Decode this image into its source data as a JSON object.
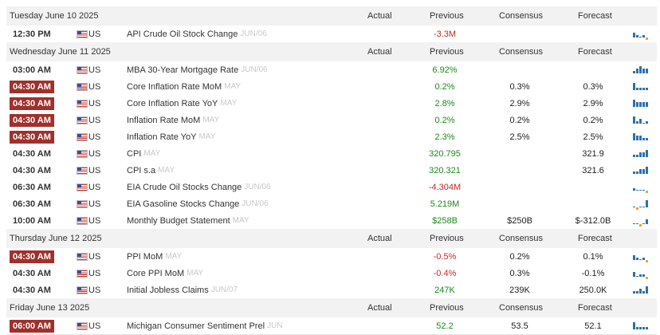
{
  "columns": {
    "actual": "Actual",
    "previous": "Previous",
    "consensus": "Consensus",
    "forecast": "Forecast"
  },
  "groups": [
    {
      "date": "Tuesday June 10 2025",
      "events": [
        {
          "time": "12:30 PM",
          "impact": "normal",
          "country": "US",
          "event": "API Crude Oil Stock Change",
          "ref": "JUN/06",
          "actual": "",
          "previous": "-3.3M",
          "previous_color": "red",
          "consensus": "",
          "forecast": "",
          "spark": [
            2,
            1,
            0,
            1,
            -1
          ]
        }
      ]
    },
    {
      "date": "Wednesday June 11 2025",
      "events": [
        {
          "time": "03:00 AM",
          "impact": "normal",
          "country": "US",
          "event": "MBA 30-Year Mortgage Rate",
          "ref": "JUN/06",
          "actual": "",
          "previous": "6.92%",
          "previous_color": "green",
          "consensus": "",
          "forecast": "",
          "spark": [
            1,
            2,
            3,
            2,
            2
          ]
        },
        {
          "time": "04:30 AM",
          "impact": "high",
          "country": "US",
          "event": "Core Inflation Rate MoM",
          "ref": "MAY",
          "actual": "",
          "previous": "0.2%",
          "previous_color": "green",
          "consensus": "0.3%",
          "forecast": "0.3%",
          "spark": [
            3,
            1,
            1,
            1,
            1
          ]
        },
        {
          "time": "04:30 AM",
          "impact": "high",
          "country": "US",
          "event": "Core Inflation Rate YoY",
          "ref": "MAY",
          "actual": "",
          "previous": "2.8%",
          "previous_color": "green",
          "consensus": "2.9%",
          "forecast": "2.9%",
          "spark": [
            3,
            2,
            2,
            2,
            2
          ]
        },
        {
          "time": "04:30 AM",
          "impact": "high",
          "country": "US",
          "event": "Inflation Rate MoM",
          "ref": "MAY",
          "actual": "",
          "previous": "0.2%",
          "previous_color": "green",
          "consensus": "0.2%",
          "forecast": "0.2%",
          "spark": [
            3,
            1,
            2,
            0,
            1
          ]
        },
        {
          "time": "04:30 AM",
          "impact": "high",
          "country": "US",
          "event": "Inflation Rate YoY",
          "ref": "MAY",
          "actual": "",
          "previous": "2.3%",
          "previous_color": "green",
          "consensus": "2.5%",
          "forecast": "2.5%",
          "spark": [
            3,
            2,
            2,
            1,
            1
          ]
        },
        {
          "time": "04:30 AM",
          "impact": "normal",
          "country": "US",
          "event": "CPI",
          "ref": "MAY",
          "actual": "",
          "previous": "320.795",
          "previous_color": "green",
          "consensus": "",
          "forecast": "321.9",
          "spark": [
            1,
            1,
            2,
            2,
            3
          ]
        },
        {
          "time": "04:30 AM",
          "impact": "normal",
          "country": "US",
          "event": "CPI s.a",
          "ref": "MAY",
          "actual": "",
          "previous": "320.321",
          "previous_color": "green",
          "consensus": "",
          "forecast": "321.6",
          "spark": [
            1,
            1,
            2,
            2,
            3
          ]
        },
        {
          "time": "06:30 AM",
          "impact": "normal",
          "country": "US",
          "event": "EIA Crude Oil Stocks Change",
          "ref": "JUN/06",
          "actual": "",
          "previous": "-4.304M",
          "previous_color": "red",
          "consensus": "",
          "forecast": "",
          "spark": [
            1,
            0,
            0,
            0,
            -2
          ]
        },
        {
          "time": "06:30 AM",
          "impact": "normal",
          "country": "US",
          "event": "EIA Gasoline Stocks Change",
          "ref": "JUN/06",
          "actual": "",
          "previous": "5.219M",
          "previous_color": "green",
          "consensus": "",
          "forecast": "",
          "spark": [
            0,
            -1,
            0,
            0,
            3
          ]
        },
        {
          "time": "10:00 AM",
          "impact": "normal",
          "country": "US",
          "event": "Monthly Budget Statement",
          "ref": "MAY",
          "actual": "",
          "previous": "$258B",
          "previous_color": "green",
          "consensus": "$250B",
          "forecast": "$-312.0B",
          "spark": [
            0,
            0,
            -1,
            0,
            2
          ]
        }
      ]
    },
    {
      "date": "Thursday June 12 2025",
      "events": [
        {
          "time": "04:30 AM",
          "impact": "high",
          "country": "US",
          "event": "PPI MoM",
          "ref": "MAY",
          "actual": "",
          "previous": "-0.5%",
          "previous_color": "red",
          "consensus": "0.2%",
          "forecast": "0.1%",
          "spark": [
            2,
            1,
            0,
            1,
            -1
          ]
        },
        {
          "time": "04:30 AM",
          "impact": "normal",
          "country": "US",
          "event": "Core PPI MoM",
          "ref": "MAY",
          "actual": "",
          "previous": "-0.4%",
          "previous_color": "red",
          "consensus": "0.3%",
          "forecast": "-0.1%",
          "spark": [
            2,
            0,
            1,
            1,
            -1
          ]
        },
        {
          "time": "04:30 AM",
          "impact": "normal",
          "country": "US",
          "event": "Initial Jobless Claims",
          "ref": "JUN/07",
          "actual": "",
          "previous": "247K",
          "previous_color": "green",
          "consensus": "239K",
          "forecast": "250.0K",
          "spark": [
            1,
            1,
            2,
            1,
            3
          ]
        }
      ]
    },
    {
      "date": "Friday June 13 2025",
      "events": [
        {
          "time": "06:00 AM",
          "impact": "high",
          "country": "US",
          "event": "Michigan Consumer Sentiment Prel",
          "ref": "JUN",
          "actual": "",
          "previous": "52.2",
          "previous_color": "green",
          "consensus": "53.5",
          "forecast": "52.1",
          "spark": [
            3,
            1,
            1,
            1,
            1
          ]
        }
      ]
    }
  ]
}
